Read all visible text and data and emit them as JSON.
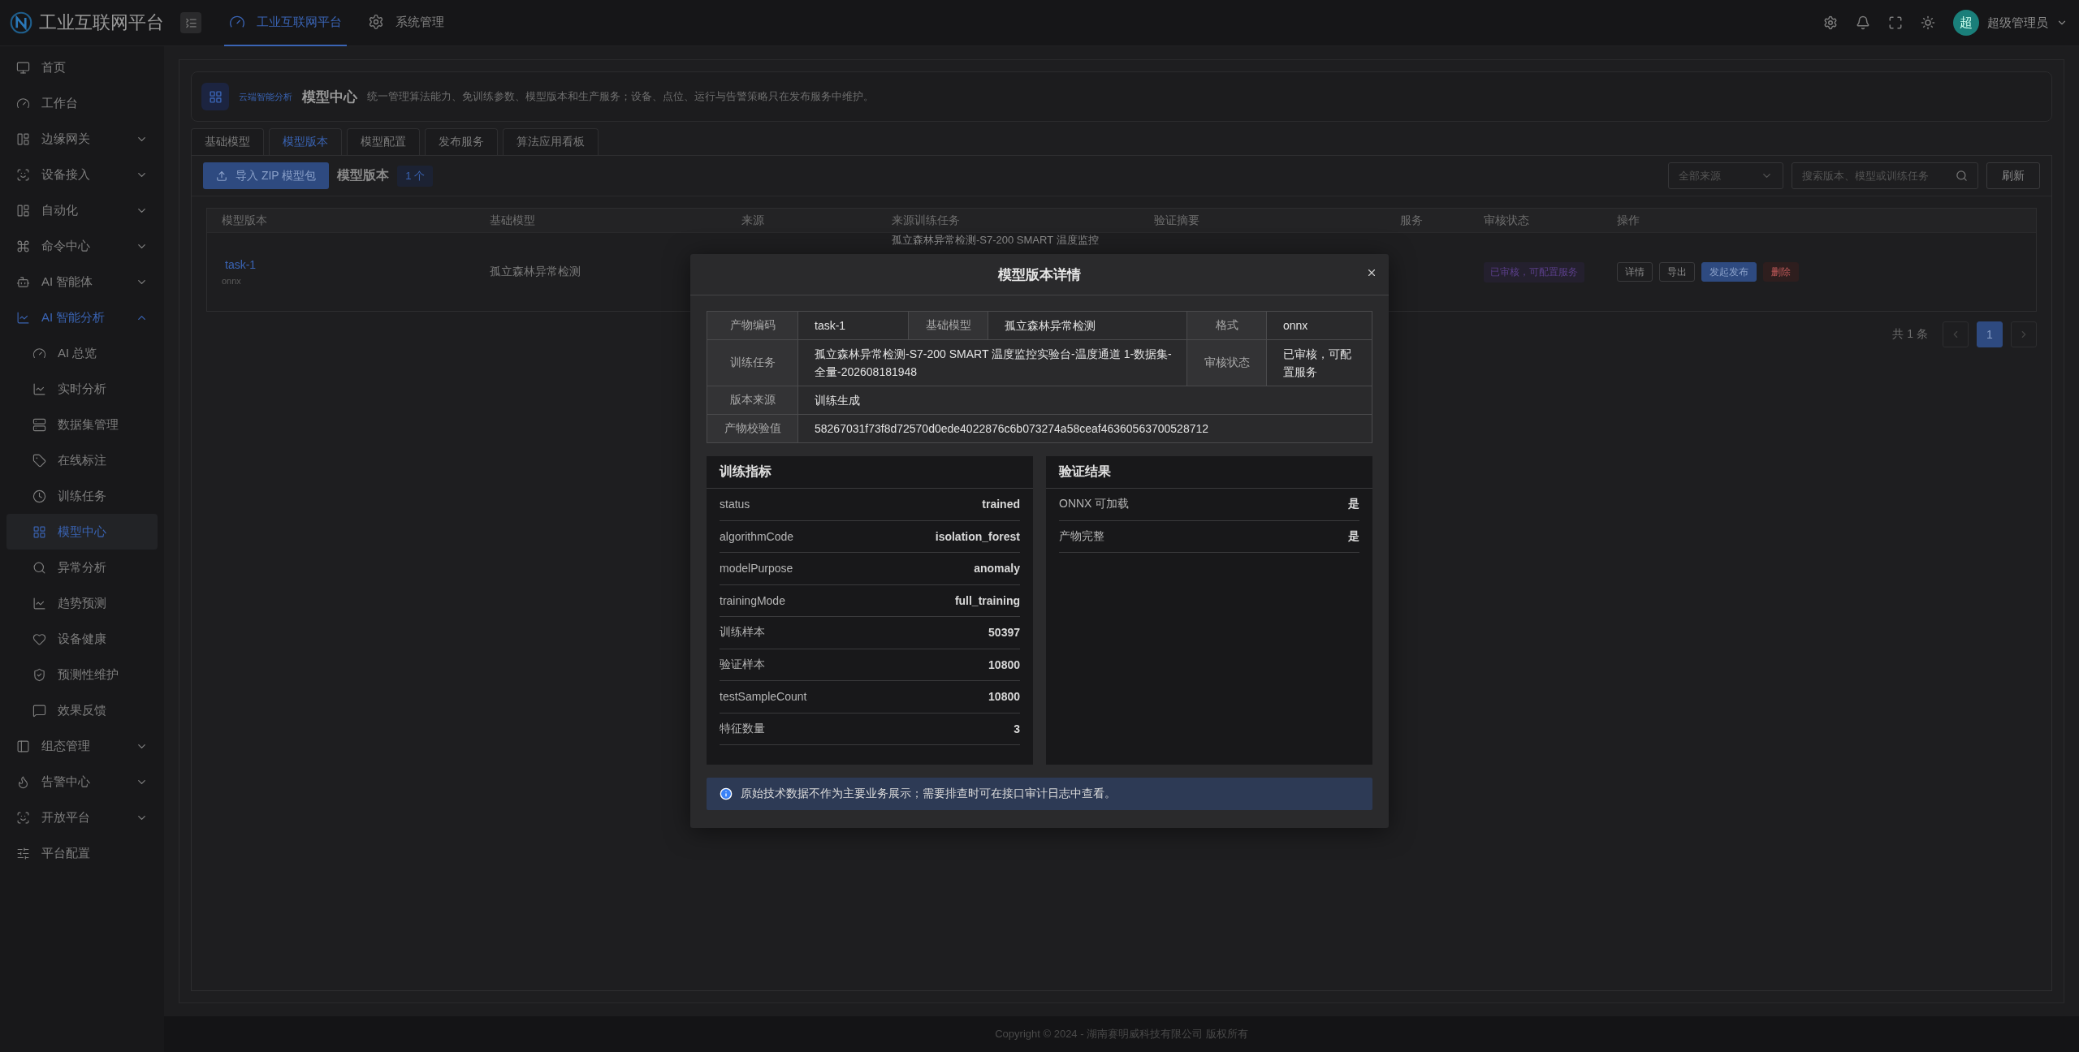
{
  "brand": {
    "title": "工业互联网平台"
  },
  "top_nav": [
    {
      "label": "工业互联网平台",
      "selected": true
    },
    {
      "label": "系统管理",
      "selected": false
    }
  ],
  "user": {
    "avatar": "超",
    "name": "超级管理员"
  },
  "sidebar": {
    "items": [
      {
        "label": "首页",
        "selected": false
      },
      {
        "label": "工作台",
        "selected": false
      },
      {
        "label": "边缘网关",
        "expanded": false,
        "selected": false
      },
      {
        "label": "设备接入",
        "expanded": false,
        "selected": false
      },
      {
        "label": "自动化",
        "expanded": false,
        "selected": false
      },
      {
        "label": "命令中心",
        "expanded": false,
        "selected": false
      },
      {
        "label": "AI 智能体",
        "expanded": false,
        "selected": false
      },
      {
        "label": "AI 智能分析",
        "expanded": true,
        "selected": false,
        "children": [
          {
            "label": "AI 总览",
            "selected": false
          },
          {
            "label": "实时分析",
            "selected": false
          },
          {
            "label": "数据集管理",
            "selected": false
          },
          {
            "label": "在线标注",
            "selected": false
          },
          {
            "label": "训练任务",
            "selected": false
          },
          {
            "label": "模型中心",
            "selected": true
          },
          {
            "label": "异常分析",
            "selected": false
          },
          {
            "label": "趋势预测",
            "selected": false
          },
          {
            "label": "设备健康",
            "selected": false
          },
          {
            "label": "预测性维护",
            "selected": false
          },
          {
            "label": "效果反馈",
            "selected": false
          }
        ]
      },
      {
        "label": "组态管理",
        "expanded": false,
        "selected": false
      },
      {
        "label": "告警中心",
        "expanded": false,
        "selected": false
      },
      {
        "label": "开放平台",
        "expanded": false,
        "selected": false
      },
      {
        "label": "平台配置",
        "selected": false
      }
    ]
  },
  "page_header": {
    "tag": "云端智能分析",
    "title": "模型中心",
    "description": "统一管理算法能力、免训练参数、模型版本和生产服务；设备、点位、运行与告警策略只在发布服务中维护。"
  },
  "tabs": [
    {
      "label": "基础模型",
      "selected": false
    },
    {
      "label": "模型版本",
      "selected": true
    },
    {
      "label": "模型配置",
      "selected": false
    },
    {
      "label": "发布服务",
      "selected": false
    },
    {
      "label": "算法应用看板",
      "selected": false
    }
  ],
  "toolbar": {
    "import_button": "导入 ZIP 模型包",
    "title": "模型版本",
    "count": "1 个",
    "source_select": {
      "placeholder": "全部来源"
    },
    "search": {
      "placeholder": "搜索版本、模型或训练任务"
    },
    "refresh_button": "刷新"
  },
  "table": {
    "columns": [
      "模型版本",
      "基础模型",
      "来源",
      "来源训练任务",
      "验证摘要",
      "服务",
      "审核状态",
      "操作"
    ],
    "rows": [
      {
        "version": "task-1",
        "format": "onnx",
        "base_model": "孤立森林异常检测",
        "training_task": "孤立森林异常检测-S7-200 SMART 温度监控",
        "status": "已审核，可配置服务",
        "actions": [
          {
            "label": "详情",
            "kind": "default"
          },
          {
            "label": "导出",
            "kind": "default"
          },
          {
            "label": "发起发布",
            "kind": "primary"
          },
          {
            "label": "删除",
            "kind": "danger"
          }
        ]
      }
    ]
  },
  "pagination": {
    "total": "共 1 条",
    "pages": [
      {
        "label": "1",
        "selected": true
      }
    ]
  },
  "footer": "Copyright © 2024 - 湖南赛明威科技有限公司 版权所有",
  "dialog": {
    "title": "模型版本详情",
    "descriptions": [
      [
        {
          "label": "产物编码",
          "value": "task-1"
        },
        {
          "label": "基础模型",
          "value": "孤立森林异常检测"
        },
        {
          "label": "格式",
          "value": "onnx"
        }
      ],
      [
        {
          "label": "训练任务",
          "value": "孤立森林异常检测-S7-200 SMART 温度监控实验台-温度通道 1-数据集-全量-202608181948"
        },
        {
          "label": "审核状态",
          "value": "已审核，可配置服务"
        }
      ],
      [
        {
          "label": "版本来源",
          "value": "训练生成"
        }
      ],
      [
        {
          "label": "产物校验值",
          "value": "58267031f73f8d72570d0ede4022876c6b073274a58ceaf46360563700528712"
        }
      ]
    ],
    "cards": [
      {
        "title": "训练指标",
        "rows": [
          {
            "label": "status",
            "value": "trained"
          },
          {
            "label": "algorithmCode",
            "value": "isolation_forest"
          },
          {
            "label": "modelPurpose",
            "value": "anomaly"
          },
          {
            "label": "trainingMode",
            "value": "full_training"
          },
          {
            "label": "训练样本",
            "value": "50397"
          },
          {
            "label": "验证样本",
            "value": "10800"
          },
          {
            "label": "testSampleCount",
            "value": "10800"
          },
          {
            "label": "特征数量",
            "value": "3"
          }
        ]
      },
      {
        "title": "验证结果",
        "rows": [
          {
            "label": "ONNX 可加载",
            "value": "是"
          },
          {
            "label": "产物完整",
            "value": "是"
          }
        ]
      }
    ],
    "notice": "原始技术数据不作为主要业务展示；需要排查时可在接口审计日志中查看。"
  }
}
